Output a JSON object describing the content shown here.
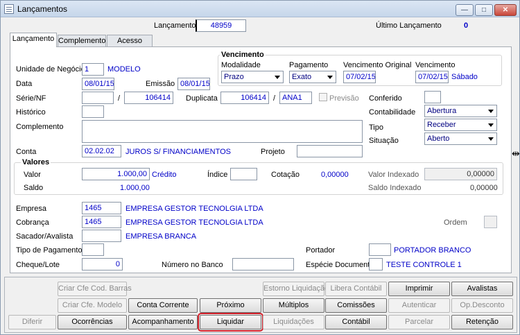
{
  "window": {
    "title": "Lançamentos",
    "min_glyph": "—",
    "max_glyph": "□",
    "close_glyph": "✕"
  },
  "header": {
    "lancamento_label": "Lançamento",
    "lancamento_value": "48959",
    "ultimo_label": "Último Lançamento",
    "ultimo_value": "0"
  },
  "tabs": [
    {
      "label": "Lançamento"
    },
    {
      "label": "Complemento"
    },
    {
      "label": "Acesso"
    }
  ],
  "vencimento": {
    "title": "Vencimento",
    "modalidade_label": "Modalidade",
    "modalidade_value": "Prazo",
    "pagamento_label": "Pagamento",
    "pagamento_value": "Exato",
    "venc_original_label": "Vencimento Original",
    "venc_original_value": "07/02/15",
    "vencimento_label": "Vencimento",
    "vencimento_value": "07/02/15",
    "dia_semana": "Sábado"
  },
  "form": {
    "unidade_label": "Unidade de Negócio",
    "unidade_code": "1",
    "unidade_name": "MODELO",
    "data_label": "Data",
    "data_value": "08/01/15",
    "emissao_label": "Emissão",
    "emissao_value": "08/01/15",
    "serie_label": "Série/NF",
    "serie_value": "",
    "slash1": "/",
    "nf_value": "106414",
    "duplicata_label": "Duplicata",
    "duplicata_value": "106414",
    "slash2": "/",
    "duplicata_suffix": "ANA1",
    "previsao_label": "Previsão",
    "conferido_label": "Conferido",
    "historico_label": "Histórico",
    "contabilidade_label": "Contabilidade",
    "contabilidade_value": "Abertura",
    "complemento_label": "Complemento",
    "tipo_label": "Tipo",
    "tipo_value": "Receber",
    "situacao_label": "Situação",
    "situacao_value": "Aberto",
    "conta_label": "Conta",
    "conta_value": "02.02.02",
    "conta_name": "JUROS S/ FINANCIAMENTOS",
    "projeto_label": "Projeto"
  },
  "valores": {
    "title": "Valores",
    "valor_label": "Valor",
    "valor_value": "1.000,00",
    "valor_type": "Crédito",
    "indice_label": "Índice",
    "cotacao_label": "Cotação",
    "cotacao_value": "0,00000",
    "valor_indexado_label": "Valor Indexado",
    "valor_indexado_value": "0,00000",
    "saldo_label": "Saldo",
    "saldo_value": "1.000,00",
    "saldo_indexado_label": "Saldo Indexado",
    "saldo_indexado_value": "0,00000"
  },
  "lower": {
    "empresa_label": "Empresa",
    "empresa_code": "1465",
    "empresa_name": "EMPRESA GESTOR TECNOLGIA LTDA",
    "cobranca_label": "Cobrança",
    "cobranca_code": "1465",
    "cobranca_name": "EMPRESA GESTOR TECNOLGIA LTDA",
    "ordem_label": "Ordem",
    "sacador_label": "Sacador/Avalista",
    "sacador_name": "EMPRESA BRANCA",
    "tipo_pagamento_label": "Tipo de Pagamento",
    "portador_label": "Portador",
    "portador_name": "PORTADOR BRANCO",
    "cheque_label": "Cheque/Lote",
    "cheque_value": "0",
    "numero_banco_label": "Número no Banco",
    "especie_label": "Espécie Documento",
    "especie_name": "TESTE CONTROLE 1"
  },
  "buttons": {
    "criar_barras": "Criar Cfe Cod. Barras",
    "estorno": "Estorno Liquidação",
    "libera_contabil": "Libera Contábil",
    "imprimir": "Imprimir",
    "avalistas": "Avalistas",
    "criar_modelo": "Criar Cfe. Modelo",
    "conta_corrente": "Conta Corrente",
    "proximo": "Próximo",
    "multiplos": "Múltiplos",
    "comissoes": "Comissões",
    "autenticar": "Autenticar",
    "op_desconto": "Op.Desconto",
    "diferir": "Diferir",
    "ocorrencias": "Ocorrências",
    "acompanhamento": "Acompanhamento",
    "liquidar": "Liquidar",
    "liquidacoes": "Liquidações",
    "contabil": "Contábil",
    "parcelar": "Parcelar",
    "retencao": "Retenção"
  }
}
